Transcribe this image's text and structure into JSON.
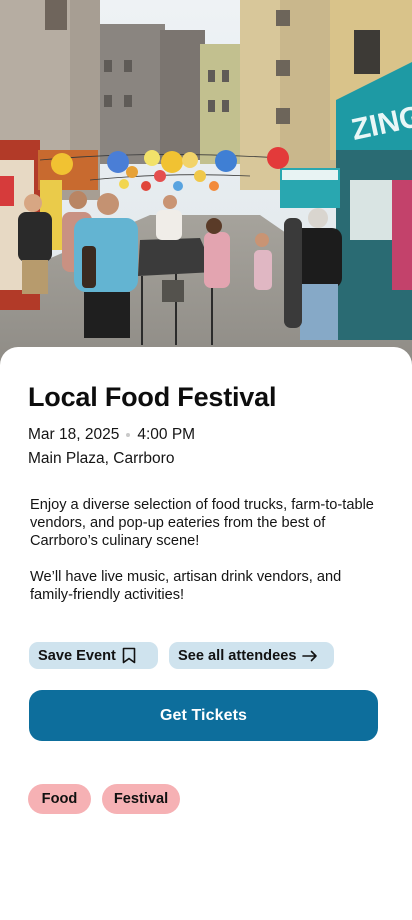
{
  "event": {
    "title": "Local Food Festival",
    "date": "Mar 18, 2025",
    "time": "4:00 PM",
    "location": "Main Plaza, Carrboro",
    "description": [
      "Enjoy a diverse selection of food trucks, farm-to-table vendors, and pop-up eateries from the best of Carrboro’s culinary scene!",
      "We’ll have live music, artisan drink vendors, and family-friendly activities!"
    ]
  },
  "hero": {
    "sign_text": "ZING"
  },
  "actions": {
    "save_label": "Save Event",
    "save_icon": "bookmark-icon",
    "attendees_label": "See all attendees",
    "attendees_icon": "arrow-right-icon",
    "primary_label": "Get Tickets"
  },
  "tags": [
    "Food",
    "Festival"
  ],
  "colors": {
    "primary": "#0d6e9c",
    "chip": "#cfe3ee",
    "tag": "#f6b1b4",
    "meta_dot": "#c9c9c9"
  }
}
